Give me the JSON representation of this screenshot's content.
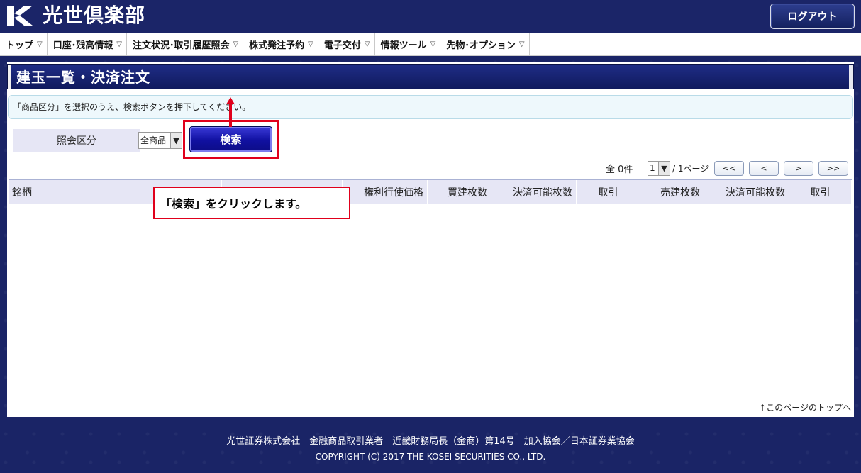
{
  "header": {
    "brand": "光世倶楽部",
    "logout_label": "ログアウト"
  },
  "nav": {
    "items": [
      {
        "label": "トップ"
      },
      {
        "label": "口座･残高情報"
      },
      {
        "label": "注文状況･取引履歴照会"
      },
      {
        "label": "株式発注予約"
      },
      {
        "label": "電子交付"
      },
      {
        "label": "情報ツール"
      },
      {
        "label": "先物･オプション"
      }
    ]
  },
  "page": {
    "title": "建玉一覧・決済注文",
    "notice": "「商品区分」を選択のうえ、検索ボタンを押下してください。",
    "filter_label": "照会区分",
    "filter_select_value": "全商品",
    "search_label": "検索"
  },
  "pager": {
    "count_text": "全 0件",
    "page_value": "1",
    "page_total": "/ 1ページ",
    "first": "<<",
    "prev": "<",
    "next": ">",
    "last": ">>"
  },
  "table": {
    "headers": [
      "銘柄",
      "",
      "",
      "権利行使価格",
      "買建枚数",
      "決済可能枚数",
      "取引",
      "売建枚数",
      "決済可能枚数",
      "取引"
    ]
  },
  "top_link": "↑このページのトップへ",
  "annotation": {
    "text": "「検索」をクリックします。",
    "color": "#e0001b"
  },
  "footer": {
    "line1": "光世証券株式会社　金融商品取引業者　近畿財務局長（金商）第14号　加入協会／日本証券業協会",
    "line2": "COPYRIGHT (C) 2017 THE KOSEI SECURITIES CO., LTD."
  },
  "colors": {
    "brand_navy": "#1b2568",
    "accent_blue": "#1010a0",
    "highlight_red": "#e0001b"
  }
}
